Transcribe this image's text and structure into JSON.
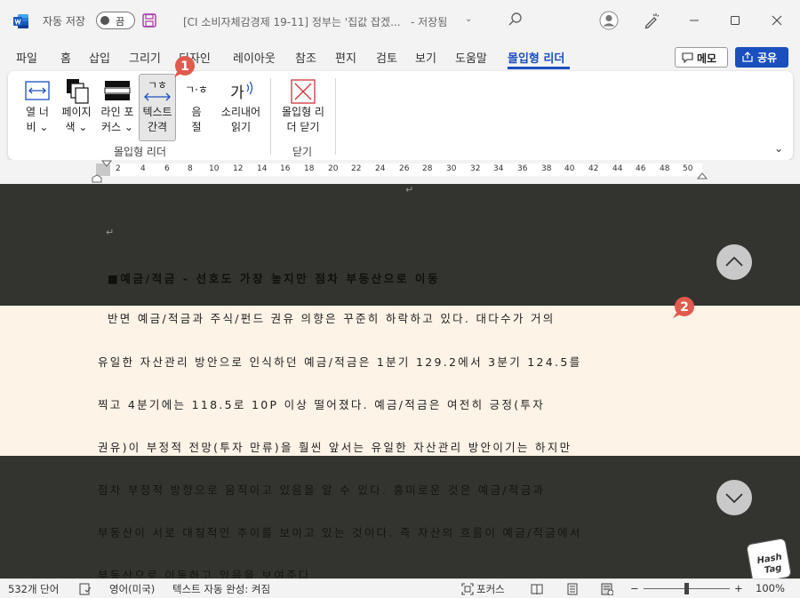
{
  "titlebar": {
    "autosave_label": "자동 저장",
    "autosave_state": "끔",
    "document_title": "[CI 소비자체감경제 19-11] 정부는 '집값 잡겠...",
    "save_status": "- 저장됨",
    "save_chevron": "⌄",
    "accent_color": "#2b579a"
  },
  "tabs": [
    {
      "label": "파일"
    },
    {
      "label": "홈"
    },
    {
      "label": "삽입"
    },
    {
      "label": "그리기"
    },
    {
      "label": "디자인"
    },
    {
      "label": "레이아웃"
    },
    {
      "label": "참조"
    },
    {
      "label": "편지"
    },
    {
      "label": "검토"
    },
    {
      "label": "보기"
    },
    {
      "label": "도움말"
    },
    {
      "label": "몰입형 리더",
      "active": true
    }
  ],
  "actions": {
    "memo_label": "메모",
    "share_label": "공유"
  },
  "ribbon": {
    "group_immersive_label": "몰입형 리더",
    "group_close_label": "닫기",
    "column_width": [
      "열 너",
      "비 ⌄"
    ],
    "page_color": [
      "페이지",
      "색 ⌄"
    ],
    "line_focus": [
      "라인 포",
      "커스 ⌄"
    ],
    "text_spacing": [
      "텍스트",
      "간격"
    ],
    "syllables": [
      "음",
      "절"
    ],
    "read_aloud": [
      "소리내어",
      "읽기"
    ],
    "close_reader": [
      "몰입형 리",
      "더 닫기"
    ],
    "collapse_glyph": "⌄",
    "text_spacing_icon_text": "ㄱㅎ",
    "syllables_icon_text": "ㄱ·ㅎ",
    "read_aloud_icon_text": "가"
  },
  "badges": {
    "one": "1",
    "two": "2"
  },
  "ruler": {
    "ticks": [
      "2",
      "4",
      "6",
      "8",
      "10",
      "12",
      "14",
      "16",
      "18",
      "20",
      "22",
      "24",
      "26",
      "28",
      "30",
      "32",
      "34",
      "36",
      "38",
      "40",
      "42",
      "44",
      "46",
      "48",
      "50"
    ]
  },
  "document": {
    "para_mark": "↵",
    "heading": "■예금/적금 - 선호도 가장 높지만 점차 부동산으로 이동",
    "lines": [
      "반면 예금/적금과 주식/펀드 권유 의향은 꾸준히 하락하고 있다. 대다수가 거의",
      "유일한 자산관리 방안으로 인식하던 예금/적금은 1분기 129.2에서 3분기 124.5를",
      "찍고 4분기에는 118.5로 10P 이상 떨어졌다. 예금/적금은 여전히 긍정(투자",
      "권유)이 부정적 전망(투자 만류)을 훨씬 앞서는 유일한 자산관리 방안이기는 하지만",
      "점차 부정적 방향으로 움직이고 있음을 알 수 있다. 흥미로운 것은 예금/적금과",
      "부동산이 서로 대칭적인 추이를 보이고 있는 것이다. 즉 자산의 흐름이 예금/적금에서",
      "부동산으로 이동하고 있음을 보여준다."
    ],
    "watermark_text": [
      "Hash",
      "Tag"
    ]
  },
  "status": {
    "word_count": "532개 단어",
    "language": "영어(미국)",
    "autocomplete": "텍스트 자동 완성: 켜짐",
    "focus": "포커스",
    "zoom_minus": "−",
    "zoom_plus": "+",
    "zoom_percent": "100%"
  }
}
